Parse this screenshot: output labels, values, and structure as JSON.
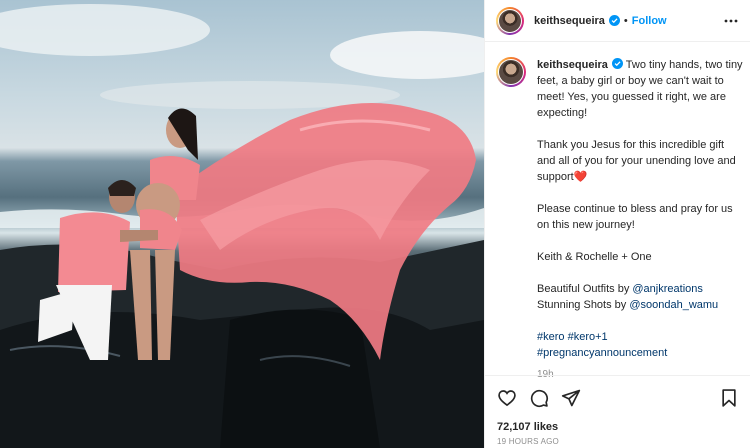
{
  "post": {
    "image_alt": "Couple in pink outfits on rocks by the sea with a flowing pink fabric train"
  },
  "header": {
    "username": "keithsequeira",
    "verified": true,
    "separator": "•",
    "follow_label": "Follow",
    "more_icon": "more-horizontal-icon"
  },
  "caption": {
    "username": "keithsequeira",
    "para1": "Two tiny hands, two tiny feet, a baby girl or boy we can't wait to meet! Yes, you guessed it right, we are expecting!",
    "para2": "Thank you Jesus for this incredible gift and all of you for your unending love and support",
    "para2_emoji": "❤️",
    "para3": "Please continue to bless and pray for us on this new journey!",
    "para4": "Keith & Rochelle + One",
    "outfits_label": "Beautiful Outfits by ",
    "outfits_handle": "@anjkreations",
    "shots_label": "Stunning Shots by ",
    "shots_handle": "@soondah_wamu",
    "hashtag1": "#kero",
    "hashtag2": "#kero+1",
    "hashtag3": "#pregnancyannouncement",
    "age": "19h"
  },
  "actions": {
    "icons": [
      "heart-icon",
      "comment-icon",
      "share-icon",
      "save-icon"
    ],
    "likes": "72,107 likes",
    "time": "19 HOURS AGO"
  },
  "colors": {
    "link": "#00376b",
    "follow": "#0095f6",
    "muted": "#8e8e8e",
    "verified": "#0095f6"
  }
}
